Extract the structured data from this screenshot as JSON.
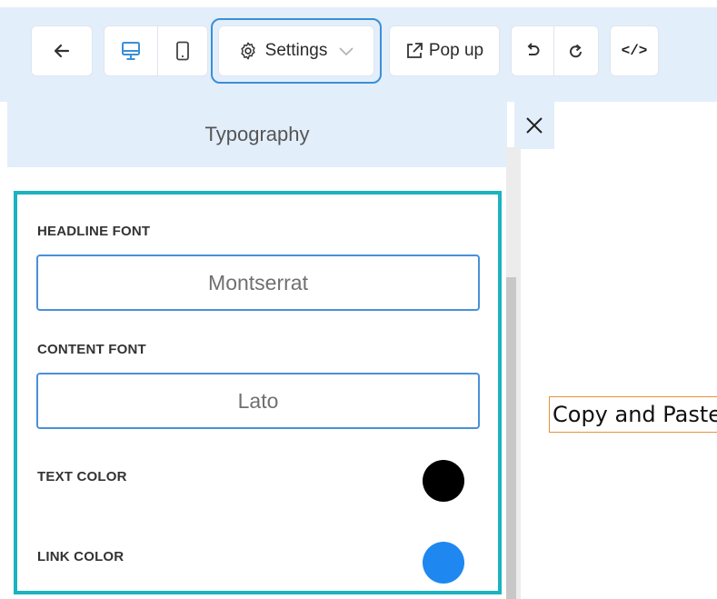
{
  "toolbar": {
    "back_icon": "arrow-left-icon",
    "desktop_icon": "monitor-icon",
    "mobile_icon": "smartphone-icon",
    "settings_label": "Settings",
    "settings_icon": "gear-icon",
    "settings_chevron": "chevron-down-icon",
    "popup_label": "Pop up",
    "popup_icon": "external-link-icon",
    "undo_icon": "undo-icon",
    "redo_icon": "redo-icon",
    "code_icon": "code-icon",
    "code_text": "</>"
  },
  "panel": {
    "title": "Typography",
    "close_icon": "close-icon",
    "headline_font_label": "HEADLINE FONT",
    "headline_font_value": "Montserrat",
    "content_font_label": "CONTENT FONT",
    "content_font_value": "Lato",
    "text_color_label": "TEXT COLOR",
    "text_color": "#000000",
    "link_color_label": "LINK COLOR",
    "link_color": "#1e88f0"
  },
  "canvas": {
    "preview_text": "Copy and Paste"
  },
  "colors": {
    "toolbar_bg": "#e3eefb",
    "accent_border": "#1bb3bf",
    "input_border": "#4a90d9",
    "active_icon": "#3b8fd6",
    "preview_border": "#e8903b"
  }
}
